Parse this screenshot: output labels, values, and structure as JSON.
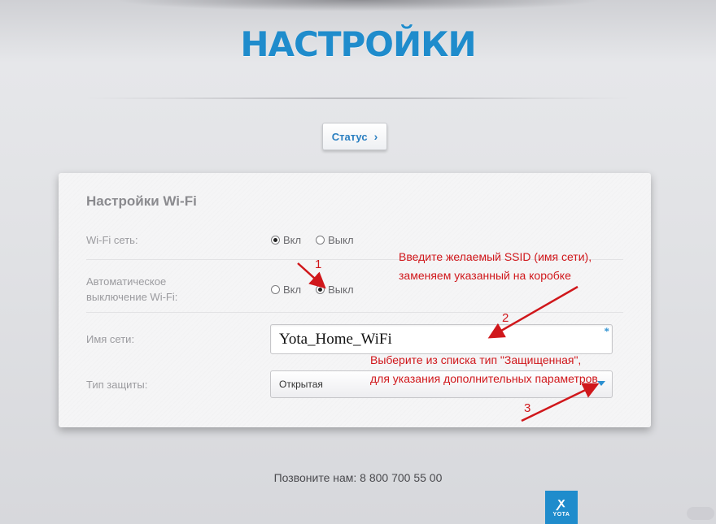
{
  "header": {
    "title": "НАСТРОЙКИ",
    "status_button": {
      "label": "Статус",
      "chevron": "›"
    }
  },
  "panel": {
    "title": "Настройки Wi-Fi",
    "wifi_network": {
      "label": "Wi-Fi сеть:",
      "options": [
        {
          "label": "Вкл",
          "checked": true
        },
        {
          "label": "Выкл",
          "checked": false
        }
      ]
    },
    "auto_off": {
      "label_line1": "Автоматическое",
      "label_line2": "выключение Wi-Fi:",
      "options": [
        {
          "label": "Вкл",
          "checked": false
        },
        {
          "label": "Выкл",
          "checked": true
        }
      ]
    },
    "network_name": {
      "label": "Имя сети:",
      "value": "Yota_Home_WiFi",
      "required_mark": "*"
    },
    "security_type": {
      "label": "Тип защиты:",
      "selected": "Открытая"
    }
  },
  "annotations": {
    "ssid_hint_line1": "Введите желаемый SSID (имя сети),",
    "ssid_hint_line2": "заменяем указанный на коробке",
    "security_hint_line1": "Выберите из списка тип \"Защищенная\",",
    "security_hint_line2": "для указания дополнительных параметров",
    "step1": "1",
    "step2": "2",
    "step3": "3",
    "color": "#d0171b"
  },
  "footer": {
    "phone_text": "Позвоните нам: 8 800 700 55 00",
    "logo_glyph": "ꭗ",
    "logo_word": "YOTA"
  },
  "colors": {
    "brand_blue": "#1f8ccc",
    "annotation_red": "#d0171b"
  }
}
